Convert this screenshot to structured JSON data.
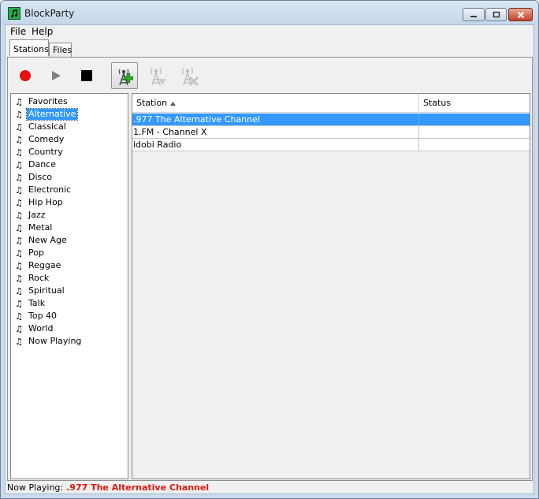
{
  "window": {
    "title": "BlockParty"
  },
  "menu": {
    "file": "File",
    "help": "Help"
  },
  "tabs": [
    {
      "label": "Stations",
      "active": true
    },
    {
      "label": "Files",
      "active": false
    }
  ],
  "toolbar": {
    "buttons": [
      {
        "icon": "record-icon",
        "color": "#e81010"
      },
      {
        "icon": "play-icon",
        "color": "#7f7f7f"
      },
      {
        "icon": "stop-icon",
        "color": "#000000"
      },
      {
        "icon": "add-station-tower-icon",
        "pressed": true
      },
      {
        "icon": "tower-icon",
        "disabled": true
      },
      {
        "icon": "remove-station-tower-icon",
        "disabled": true
      }
    ]
  },
  "genres": [
    {
      "label": "Favorites"
    },
    {
      "label": "Alternative",
      "selected": true
    },
    {
      "label": "Classical"
    },
    {
      "label": "Comedy"
    },
    {
      "label": "Country"
    },
    {
      "label": "Dance"
    },
    {
      "label": "Disco"
    },
    {
      "label": "Electronic"
    },
    {
      "label": "Hip Hop"
    },
    {
      "label": "Jazz"
    },
    {
      "label": "Metal"
    },
    {
      "label": "New Age"
    },
    {
      "label": "Pop"
    },
    {
      "label": "Reggae"
    },
    {
      "label": "Rock"
    },
    {
      "label": "Spiritual"
    },
    {
      "label": "Talk"
    },
    {
      "label": "Top 40"
    },
    {
      "label": "World"
    },
    {
      "label": "Now Playing"
    }
  ],
  "table": {
    "columns": {
      "station": "Station",
      "status": "Status"
    },
    "sort": "ascending",
    "rows": [
      {
        "station": ".977 The Alternative Channel",
        "status": "",
        "selected": true
      },
      {
        "station": "1.FM - Channel X",
        "status": ""
      },
      {
        "station": "idobi Radio",
        "status": ""
      }
    ]
  },
  "status": {
    "label": "Now Playing:",
    "value": ".977 The Alternative Channel",
    "value_color": "#e0180c"
  },
  "colors": {
    "selection": "#3399ff",
    "app_icon": "#22b14c"
  }
}
